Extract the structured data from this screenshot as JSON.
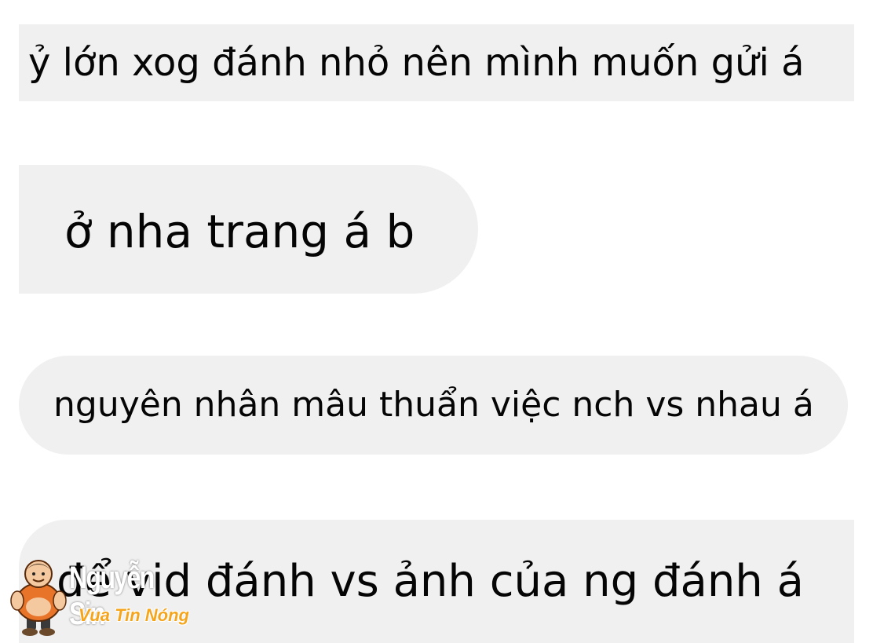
{
  "messages": [
    {
      "text": "ỷ lớn xog đánh nhỏ nên mình muốn gửi á"
    },
    {
      "text": "ở nha trang á b"
    },
    {
      "text": "nguyên nhân mâu thuẩn việc nch vs nhau á"
    },
    {
      "text": "để vid đánh vs ảnh của ng đánh á"
    }
  ],
  "watermark": {
    "name": "Nguyễn Sin",
    "tagline": "Vua Tin Nóng"
  },
  "colors": {
    "bubble_bg": "#f0f0f0",
    "text": "#050505",
    "watermark_accent": "#f5a51c"
  }
}
